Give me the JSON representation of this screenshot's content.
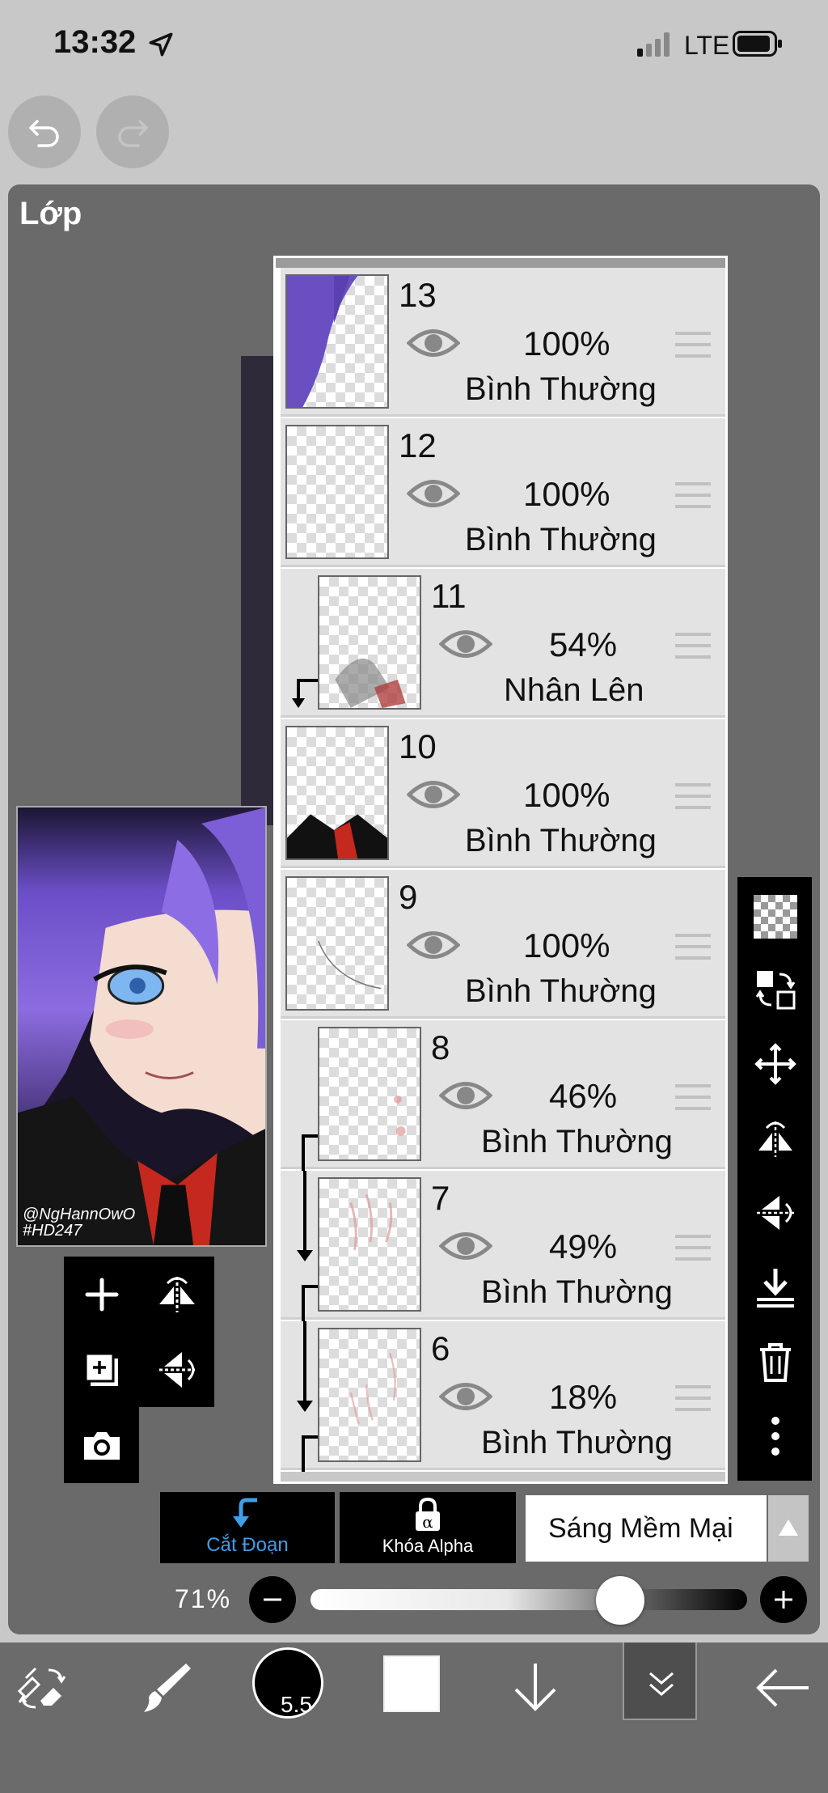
{
  "status_bar": {
    "time": "13:32",
    "network": "LTE"
  },
  "panel": {
    "title": "Lớp"
  },
  "preview": {
    "signature_line1": "@NgHannOwO",
    "signature_line2": "#HD247"
  },
  "layers": [
    {
      "number": "13",
      "opacity": "100%",
      "mode": "Bình Thường",
      "clipped": false
    },
    {
      "number": "12",
      "opacity": "100%",
      "mode": "Bình Thường",
      "clipped": false
    },
    {
      "number": "11",
      "opacity": "54%",
      "mode": "Nhân Lên",
      "clipped": true
    },
    {
      "number": "10",
      "opacity": "100%",
      "mode": "Bình Thường",
      "clipped": false
    },
    {
      "number": "9",
      "opacity": "100%",
      "mode": "Bình Thường",
      "clipped": false
    },
    {
      "number": "8",
      "opacity": "46%",
      "mode": "Bình Thường",
      "clipped": true
    },
    {
      "number": "7",
      "opacity": "49%",
      "mode": "Bình Thường",
      "clipped": true
    },
    {
      "number": "6",
      "opacity": "18%",
      "mode": "Bình Thường",
      "clipped": true
    }
  ],
  "blend": {
    "clip_label": "Cắt Đoạn",
    "alpha_lock_label": "Khóa Alpha",
    "mode_value": "Sáng Mềm Mại"
  },
  "opacity": {
    "label": "71%",
    "value": 0.71
  },
  "brush": {
    "size": "5.5"
  },
  "colors": {
    "accent": "#3f9ee8",
    "panel": "#6a6a6a",
    "row": "#e3e3e3"
  }
}
